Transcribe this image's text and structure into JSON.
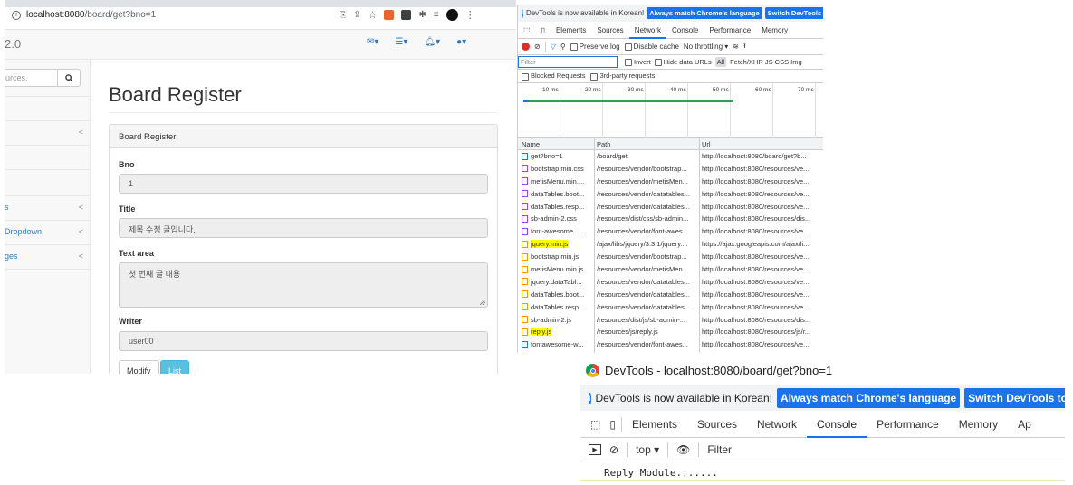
{
  "browser": {
    "url_host": "localhost:8080",
    "url_path": "/board/get?bno=1",
    "brand": "2.0"
  },
  "sidebar": {
    "search_placeholder": "urces.",
    "items": [
      {
        "label": "",
        "chevron": "<"
      },
      {
        "label": "",
        "chevron": ""
      },
      {
        "label": "s",
        "chevron": "<"
      },
      {
        "label": "Dropdown",
        "chevron": "<"
      },
      {
        "label": "ges",
        "chevron": "<"
      }
    ]
  },
  "page": {
    "title": "Board Register",
    "panel_heading": "Board Register",
    "fields": {
      "bno_label": "Bno",
      "bno_value": "1",
      "title_label": "Title",
      "title_value": "제목 수정 글입니다.",
      "text_label": "Text area",
      "text_value": "첫 번째 글 내용",
      "writer_label": "Writer",
      "writer_value": "user00"
    },
    "buttons": {
      "modify": "Modify",
      "list": "List"
    }
  },
  "devtools_top": {
    "info_text": "DevTools is now available in Korean!",
    "btn_match": "Always match Chrome's language",
    "btn_switch": "Switch DevTools",
    "tabs": [
      "Elements",
      "Sources",
      "Network",
      "Console",
      "Performance",
      "Memory"
    ],
    "active_tab": "Network",
    "toolbar": {
      "preserve_log": "Preserve log",
      "disable_cache": "Disable cache",
      "throttling": "No throttling"
    },
    "filter": {
      "placeholder": "Filter",
      "invert": "Invert",
      "hide_data": "Hide data URLs",
      "all": "All",
      "types": "Fetch/XHR  JS  CSS  Img"
    },
    "blocked_requests": "Blocked Requests",
    "third_party": "3rd-party requests",
    "timeline_ticks": [
      "10 ms",
      "20 ms",
      "30 ms",
      "40 ms",
      "50 ms",
      "60 ms",
      "70 ms"
    ],
    "columns": {
      "name": "Name",
      "path": "Path",
      "url": "Url"
    },
    "rows": [
      {
        "name": "get?bno=1",
        "path": "/board/get",
        "url": "http://localhost:8080/board/get?b...",
        "type": "doc",
        "highlight": false
      },
      {
        "name": "bootstrap.min.css",
        "path": "/resources/vendor/bootstrap...",
        "url": "http://localhost:8080/resources/ve...",
        "type": "css",
        "highlight": false
      },
      {
        "name": "metisMenu.min....",
        "path": "/resources/vendor/metisMen...",
        "url": "http://localhost:8080/resources/ve...",
        "type": "css",
        "highlight": false
      },
      {
        "name": "dataTables.boot...",
        "path": "/resources/vendor/datatables...",
        "url": "http://localhost:8080/resources/ve...",
        "type": "css",
        "highlight": false
      },
      {
        "name": "dataTables.resp...",
        "path": "/resources/vendor/datatables...",
        "url": "http://localhost:8080/resources/ve...",
        "type": "css",
        "highlight": false
      },
      {
        "name": "sb-admin-2.css",
        "path": "/resources/dist/css/sb-admin...",
        "url": "http://localhost:8080/resources/dis...",
        "type": "css",
        "highlight": false
      },
      {
        "name": "font-awesome....",
        "path": "/resources/vendor/font-awes...",
        "url": "http://localhost:8080/resources/ve...",
        "type": "css",
        "highlight": false
      },
      {
        "name": "jquery.min.js",
        "path": "/ajax/libs/jquery/3.3.1/jquery....",
        "url": "https://ajax.googleapis.com/ajax/li...",
        "type": "js",
        "highlight": true
      },
      {
        "name": "bootstrap.min.js",
        "path": "/resources/vendor/bootstrap...",
        "url": "http://localhost:8080/resources/ve...",
        "type": "js",
        "highlight": false
      },
      {
        "name": "metisMenu.min.js",
        "path": "/resources/vendor/metisMen...",
        "url": "http://localhost:8080/resources/ve...",
        "type": "js",
        "highlight": false
      },
      {
        "name": "jquery.dataTabl...",
        "path": "/resources/vendor/datatables...",
        "url": "http://localhost:8080/resources/ve...",
        "type": "js",
        "highlight": false
      },
      {
        "name": "dataTables.boot...",
        "path": "/resources/vendor/datatables...",
        "url": "http://localhost:8080/resources/ve...",
        "type": "js",
        "highlight": false
      },
      {
        "name": "dataTables.resp...",
        "path": "/resources/vendor/datatables...",
        "url": "http://localhost:8080/resources/ve...",
        "type": "js",
        "highlight": false
      },
      {
        "name": "sb-admin-2.js",
        "path": "/resources/dist/js/sb-admin-...",
        "url": "http://localhost:8080/resources/dis...",
        "type": "js",
        "highlight": false
      },
      {
        "name": "reply.js",
        "path": "/resources/js/reply.js",
        "url": "http://localhost:8080/resources/js/r...",
        "type": "js",
        "highlight": true
      },
      {
        "name": "fontawesome-w...",
        "path": "/resources/vendor/font-awes...",
        "url": "http://localhost:8080/resources/ve...",
        "type": "font",
        "highlight": false
      }
    ]
  },
  "devtools_bottom": {
    "window_title": "DevTools - localhost:8080/board/get?bno=1",
    "info_text": "DevTools is now available in Korean!",
    "btn_match": "Always match Chrome's language",
    "btn_switch": "Switch DevTools to",
    "tabs": [
      "Elements",
      "Sources",
      "Network",
      "Console",
      "Performance",
      "Memory",
      "Ap"
    ],
    "active_tab": "Console",
    "context": "top",
    "filter_placeholder": "Filter",
    "message": "Reply Module......."
  },
  "colors": {
    "accent": "#1a73e8",
    "link": "#337ab7",
    "highlight": "#ffff00",
    "list_button": "#5bc0de"
  }
}
